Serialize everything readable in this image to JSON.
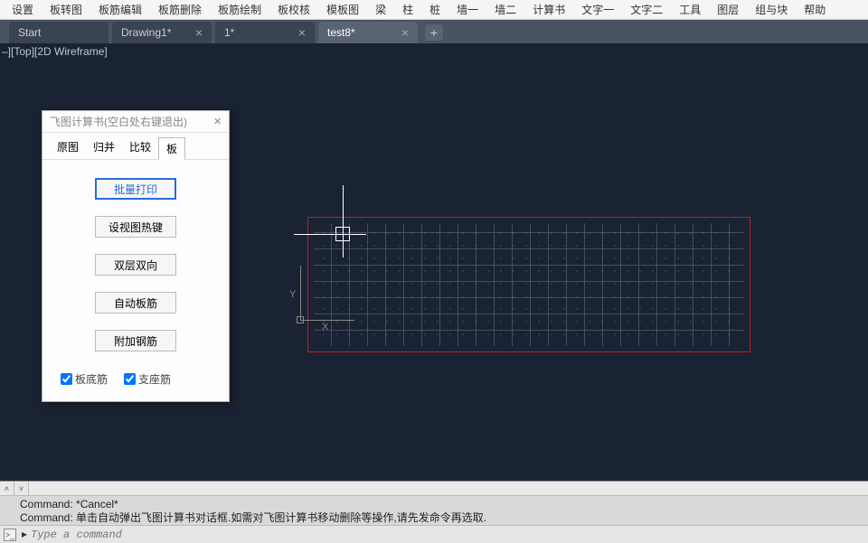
{
  "menubar": [
    "设置",
    "板转图",
    "板筋编辑",
    "板筋删除",
    "板筋绘制",
    "板校核",
    "模板图",
    "梁",
    "柱",
    "桩",
    "墙一",
    "墙二",
    "计算书",
    "文字一",
    "文字二",
    "工具",
    "图层",
    "组与块",
    "帮助"
  ],
  "tabs": [
    {
      "label": "Start",
      "active": false,
      "closable": false
    },
    {
      "label": "Drawing1*",
      "active": false,
      "closable": true
    },
    {
      "label": "1*",
      "active": false,
      "closable": true
    },
    {
      "label": "test8*",
      "active": true,
      "closable": true
    }
  ],
  "viewport_label": "–][Top][2D Wireframe]",
  "ucs": {
    "x": "X",
    "y": "Y"
  },
  "dialog": {
    "title": "飞图计算书(空白处右键退出)",
    "close": "×",
    "tabs": [
      "原图",
      "归并",
      "比较",
      "板"
    ],
    "active_tab": 3,
    "buttons": [
      "批量打印",
      "设视图热键",
      "双层双向",
      "自动板筋",
      "附加钢筋"
    ],
    "checkboxes": [
      {
        "label": "板底筋",
        "checked": true
      },
      {
        "label": "支座筋",
        "checked": true
      }
    ]
  },
  "command": {
    "line1": "Command: *Cancel*",
    "line2": "Command: 单击自动弹出飞图计算书对话框.如需对飞图计算书移动删除等操作,请先发命令再选取.",
    "prompt_icon": ">_",
    "caret": "▸",
    "placeholder": "Type a command"
  },
  "tab_add": "+"
}
